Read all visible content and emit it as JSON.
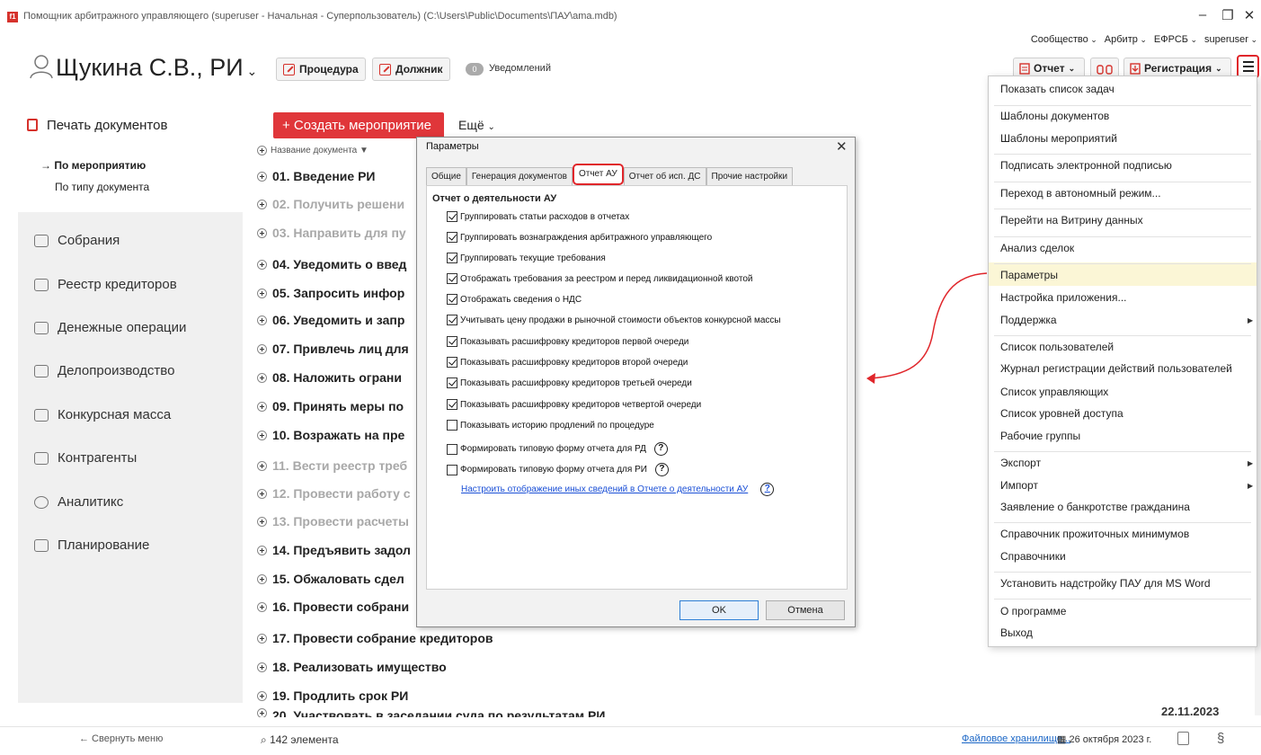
{
  "window": {
    "title": "Помощник арбитражного управляющего (superuser - Начальная - Суперпользователь) (C:\\Users\\Public\\Documents\\ПАУ\\ama.mdb)",
    "logo": "f1",
    "controls": {
      "minimize": "–",
      "restore": "❐",
      "close": "✕"
    }
  },
  "top_links": [
    "Сообщество",
    "Арбитр",
    "ЕФРСБ",
    "superuser"
  ],
  "header": {
    "person": "Щукина С.В., РИ",
    "procedure_btn": "Процедура",
    "debtor_btn": "Должник",
    "notifications_count": "0",
    "notifications_label": "Уведомлений",
    "report_btn": "Отчет",
    "registration_btn": "Регистрация"
  },
  "sidebar": {
    "print_docs": "Печать документов",
    "by_event": "→ По мероприятию",
    "by_doc_type": "По типу документа",
    "items": [
      "Собрания",
      "Реестр кредиторов",
      "Денежные операции",
      "Делопроизводство",
      "Конкурсная масса",
      "Контрагенты",
      "Аналитикс",
      "Планирование"
    ],
    "collapse": "← Свернуть меню"
  },
  "main": {
    "create_btn": "+ Создать мероприятие",
    "more_btn": "Ещё",
    "column_header": "Название документа ▼",
    "rows": [
      {
        "label": "01. Введение РИ",
        "gray": false
      },
      {
        "label": "02. Получить решени",
        "gray": true
      },
      {
        "label": "03. Направить для пу",
        "gray": true
      },
      {
        "label": "04. Уведомить о введ",
        "gray": false
      },
      {
        "label": "05. Запросить инфор",
        "gray": false
      },
      {
        "label": "06. Уведомить и запр",
        "gray": false
      },
      {
        "label": "07. Привлечь лиц для",
        "gray": false
      },
      {
        "label": "08. Наложить ограни",
        "gray": false
      },
      {
        "label": "09. Принять меры по",
        "gray": false
      },
      {
        "label": "10. Возражать на пре",
        "gray": false
      },
      {
        "label": "11. Вести реестр треб",
        "gray": true
      },
      {
        "label": "12. Провести работу с",
        "gray": true
      },
      {
        "label": "13. Провести расчеты",
        "gray": true
      },
      {
        "label": "14. Предъявить задол",
        "gray": false
      },
      {
        "label": "15. Обжаловать сдел",
        "gray": false
      },
      {
        "label": "16. Провести собрани",
        "gray": false
      },
      {
        "label": "17. Провести собрание кредиторов",
        "gray": false
      },
      {
        "label": "18. Реализовать имущество",
        "gray": false
      },
      {
        "label": "19. Продлить срок РИ",
        "gray": false
      },
      {
        "label": "20. Участвовать в заседании суда по результатам РИ",
        "gray": false
      }
    ],
    "last_row_date": "22.11.2023"
  },
  "status": {
    "count": "142 элемента",
    "storage": "Файловое хранилище...",
    "date": "26 октября 2023 г.",
    "section_sign": "§"
  },
  "dialog": {
    "title": "Параметры",
    "tabs": [
      "Общие",
      "Генерация документов",
      "Отчет АУ",
      "Отчет об исп. ДС",
      "Прочие настройки"
    ],
    "active_tab": 2,
    "section_title": "Отчет о деятельности АУ",
    "options": [
      {
        "label": "Группировать статьи расходов в отчетах",
        "checked": true,
        "help": false
      },
      {
        "label": "Группировать вознаграждения арбитражного управляющего",
        "checked": true,
        "help": false
      },
      {
        "label": "Группировать текущие требования",
        "checked": true,
        "help": false
      },
      {
        "label": "Отображать требования за реестром и перед ликвидационной квотой",
        "checked": true,
        "help": false
      },
      {
        "label": "Отображать сведения о НДС",
        "checked": true,
        "help": false
      },
      {
        "label": "Учитывать цену продажи в рыночной стоимости объектов конкурсной массы",
        "checked": true,
        "help": false
      },
      {
        "label": "Показывать расшифровку кредиторов первой очереди",
        "checked": true,
        "help": false
      },
      {
        "label": "Показывать расшифровку кредиторов второй очереди",
        "checked": true,
        "help": false
      },
      {
        "label": "Показывать расшифровку кредиторов третьей очереди",
        "checked": true,
        "help": false
      },
      {
        "label": "Показывать расшифровку кредиторов четвертой очереди",
        "checked": true,
        "help": false
      },
      {
        "label": "Показывать историю продлений по процедуре",
        "checked": false,
        "help": false
      },
      {
        "label": "Формировать типовую форму отчета для РД",
        "checked": false,
        "help": true
      },
      {
        "label": "Формировать типовую форму отчета для РИ",
        "checked": false,
        "help": true
      }
    ],
    "config_link": "Настроить отображение иных сведений в Отчете о деятельности АУ",
    "help_glyph": "?",
    "ok": "OK",
    "cancel": "Отмена"
  },
  "menu": {
    "items": [
      {
        "label": "Показать список задач"
      },
      {
        "label": "Шаблоны документов"
      },
      {
        "label": "Шаблоны мероприятий"
      },
      {
        "label": "Подписать электронной подписью"
      },
      {
        "label": "Переход в автономный режим..."
      },
      {
        "label": "Перейти на Витрину данных"
      },
      {
        "label": "Анализ сделок"
      },
      {
        "label": "Параметры",
        "highlighted": true
      },
      {
        "label": "Настройка приложения..."
      },
      {
        "label": "Поддержка",
        "submenu": true
      },
      {
        "label": "Список пользователей"
      },
      {
        "label": "Журнал регистрации действий пользователей"
      },
      {
        "label": "Список управляющих"
      },
      {
        "label": "Список уровней доступа"
      },
      {
        "label": "Рабочие группы"
      },
      {
        "label": "Экспорт",
        "submenu": true
      },
      {
        "label": "Импорт",
        "submenu": true
      },
      {
        "label": "Заявление о банкротстве гражданина"
      },
      {
        "label": "Справочник прожиточных минимумов"
      },
      {
        "label": "Справочники"
      },
      {
        "label": "Установить надстройку ПАУ для MS Word"
      },
      {
        "label": "О программе"
      },
      {
        "label": "Выход"
      }
    ]
  },
  "colors": {
    "accent": "#e0363a",
    "highlight": "#fbf6d6",
    "link": "#1a4fd6",
    "outline": "#e0262b"
  }
}
